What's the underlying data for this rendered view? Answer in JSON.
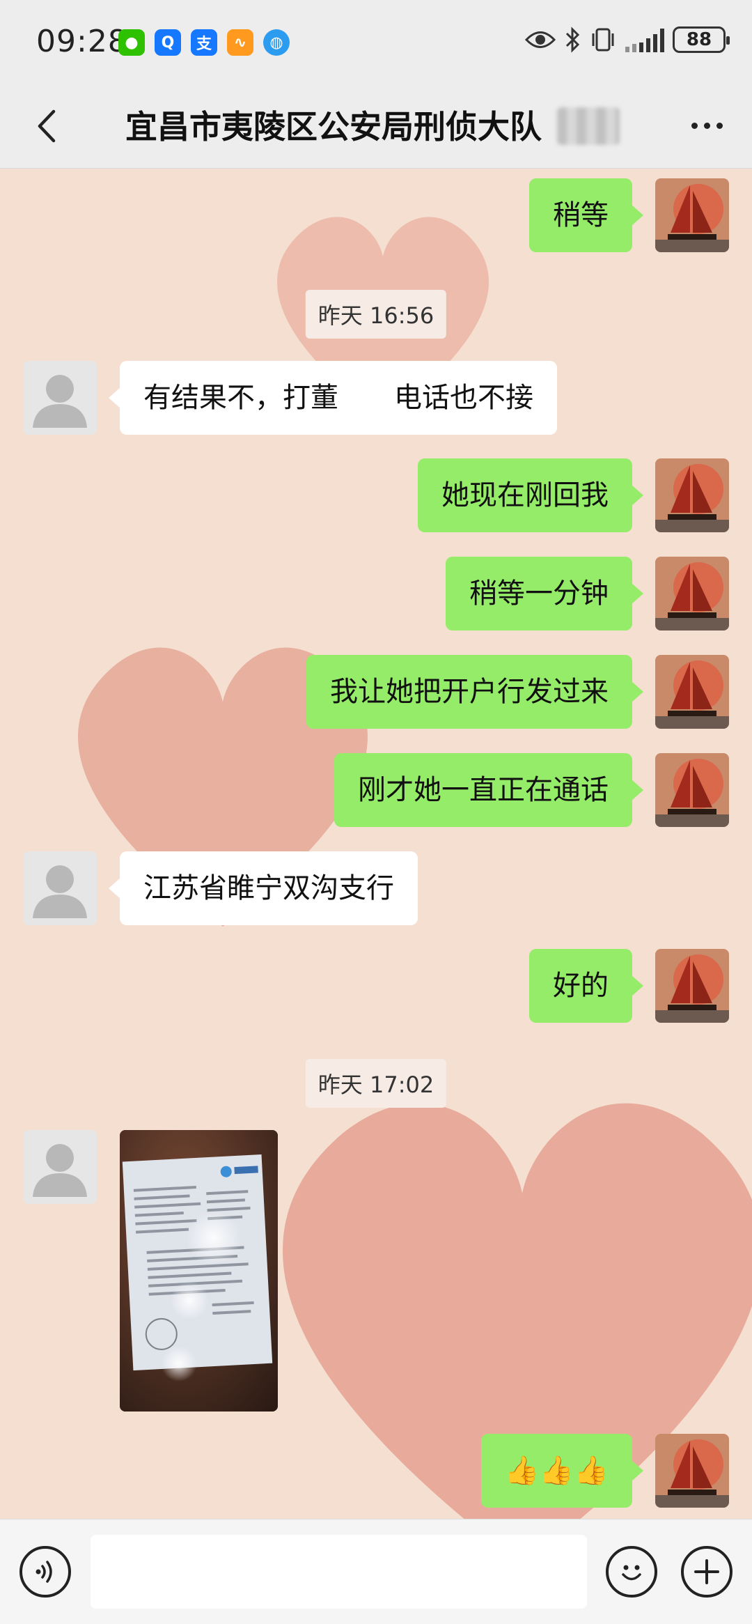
{
  "status_bar": {
    "time": "09:28",
    "battery": "88",
    "notification_icons": [
      {
        "name": "wechat-icon",
        "color": "#2dc100",
        "glyph": "💬"
      },
      {
        "name": "qq-icon",
        "color": "#1677ff",
        "glyph": "Q"
      },
      {
        "name": "alipay-icon",
        "color": "#1677ff",
        "glyph": "支"
      },
      {
        "name": "app-icon-orange",
        "color": "#ff9a1f",
        "glyph": "⟡"
      },
      {
        "name": "browser-icon",
        "color": "#2c9cf0",
        "glyph": "◍"
      }
    ]
  },
  "header": {
    "title": "宜昌市夷陵区公安局刑侦大队"
  },
  "chat": {
    "messages": [
      {
        "sender": "me",
        "text": "稍等"
      },
      {
        "type": "timestamp",
        "text": "昨天 16:56"
      },
      {
        "sender": "other",
        "text_a": "有结果不，打董",
        "text_b": "电话也不接"
      },
      {
        "sender": "me",
        "text": "她现在刚回我"
      },
      {
        "sender": "me",
        "text": "稍等一分钟"
      },
      {
        "sender": "me",
        "text": "我让她把开户行发过来"
      },
      {
        "sender": "me",
        "text": "刚才她一直正在通话"
      },
      {
        "sender": "other",
        "text": "江苏省睢宁双沟支行"
      },
      {
        "sender": "me",
        "text": "好的"
      },
      {
        "type": "timestamp",
        "text": "昨天 17:02"
      },
      {
        "sender": "other",
        "type": "image",
        "description": "bank document photo"
      },
      {
        "sender": "me",
        "text": "👍👍👍"
      }
    ]
  },
  "input_bar": {
    "voice_icon": "voice-icon",
    "emoji_icon": "emoji-icon",
    "add_icon": "plus-icon"
  },
  "colors": {
    "my_bubble": "#95ec69",
    "other_bubble": "#ffffff",
    "chat_background": "#f4dfd1"
  }
}
